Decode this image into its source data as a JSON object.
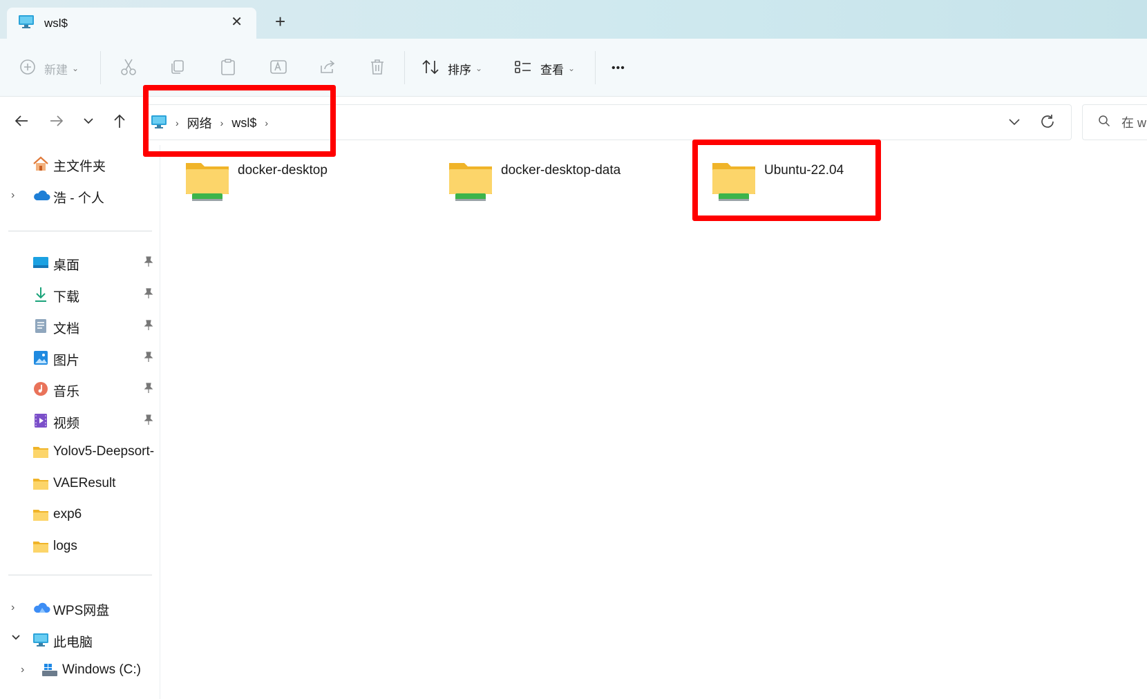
{
  "tab": {
    "title": "wsl$",
    "close": "✕",
    "new": "+"
  },
  "toolbar": {
    "new_label": "新建",
    "sort_label": "排序",
    "view_label": "查看",
    "more": "•••"
  },
  "address": {
    "crumbs": [
      "网络",
      "wsl$"
    ],
    "separator": "›"
  },
  "search": {
    "placeholder": "在 w"
  },
  "sidebar": {
    "home": "主文件夹",
    "onedrive": "浩 - 个人",
    "pinned": [
      {
        "label": "桌面",
        "icon": "desktop-icon"
      },
      {
        "label": "下载",
        "icon": "download-icon"
      },
      {
        "label": "文档",
        "icon": "document-icon"
      },
      {
        "label": "图片",
        "icon": "pictures-icon"
      },
      {
        "label": "音乐",
        "icon": "music-icon"
      },
      {
        "label": "视频",
        "icon": "video-icon"
      }
    ],
    "folders": [
      "Yolov5-Deepsort-",
      "VAEResult",
      "exp6",
      "logs"
    ],
    "wps": "WPS网盘",
    "thispc": "此电脑",
    "drive_c": "Windows (C:)"
  },
  "content": {
    "folders": [
      "docker-desktop",
      "docker-desktop-data",
      "Ubuntu-22.04"
    ]
  },
  "colors": {
    "highlight": "#ff0000",
    "folder": "#f7c94b",
    "share": "#3cb44b"
  }
}
